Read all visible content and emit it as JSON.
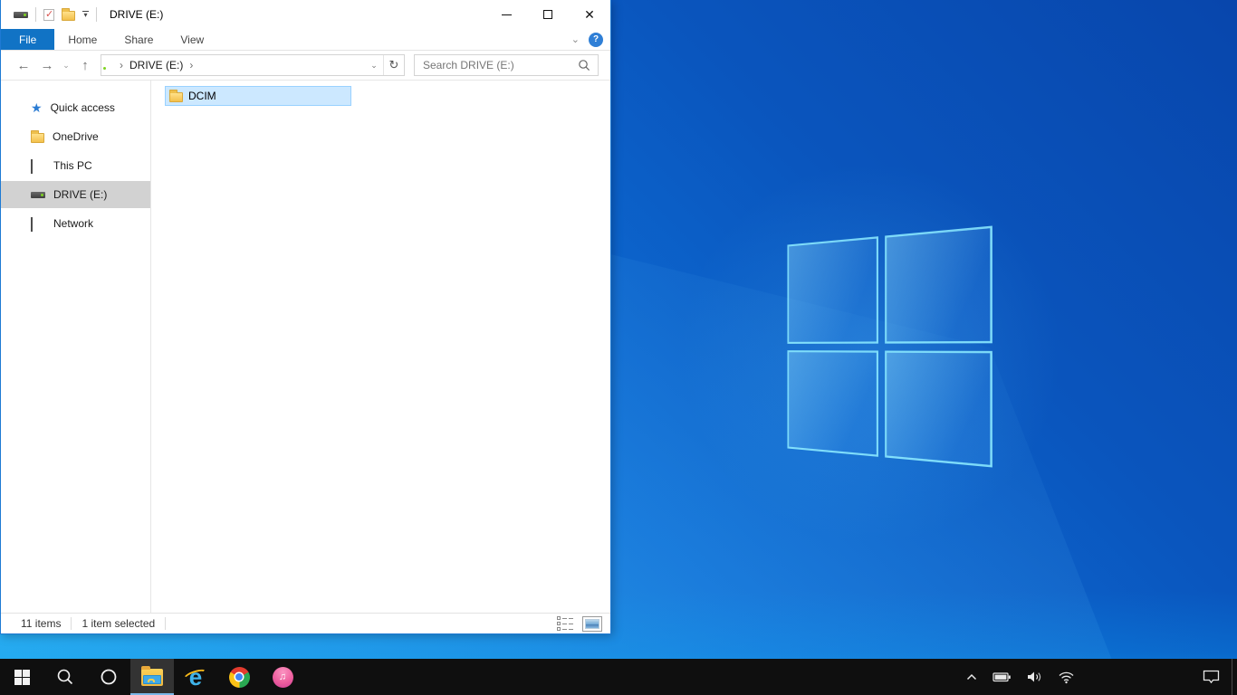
{
  "colors": {
    "accent": "#0078d7",
    "file_tab_bg": "#1173c5",
    "selection_bg": "#cce8ff",
    "selection_border": "#99d1ff",
    "sidebar_selected_bg": "#d2d2d2",
    "taskbar_bg": "#0f0f0f",
    "taskbar_active_underline": "#7ab7e8",
    "wallpaper_dark": "#0846ac",
    "wallpaper_bright": "#14a0ec",
    "logo_pane_border": "#8ceaff",
    "folder_yellow": "#f3c04b"
  },
  "glyphs": {
    "back": "←",
    "forward": "→",
    "up": "↑",
    "chevron_down": "⌄",
    "crumb_sep": "›",
    "refresh": "↻",
    "close": "✕",
    "help": "?",
    "quick_access_star": "★",
    "properties_check": "✓",
    "qat_dropdown": "▾",
    "ie_letter": "e",
    "music_note": "♫"
  },
  "window": {
    "title": "DRIVE (E:)",
    "qat_icons": [
      "drive-icon",
      "properties-icon",
      "new-folder-icon",
      "customize-qat-dropdown"
    ],
    "tabs": [
      {
        "label": "File",
        "active": true
      },
      {
        "label": "Home",
        "active": false
      },
      {
        "label": "Share",
        "active": false
      },
      {
        "label": "View",
        "active": false
      }
    ],
    "nav": {
      "address_crumb": "DRIVE (E:)",
      "search_placeholder": "Search DRIVE (E:)"
    },
    "sidebar": {
      "items": [
        {
          "label": "Quick access",
          "icon": "quick-access-star",
          "selected": false
        },
        {
          "label": "OneDrive",
          "icon": "folder",
          "selected": false
        },
        {
          "label": "This PC",
          "icon": "computer-monitor",
          "selected": false
        },
        {
          "label": "DRIVE (E:)",
          "icon": "hard-drive",
          "selected": true
        },
        {
          "label": "Network",
          "icon": "network-computer",
          "selected": false
        }
      ]
    },
    "files": [
      {
        "name": "DCIM",
        "type": "folder",
        "selected": true
      }
    ],
    "status": {
      "item_count": "11 items",
      "selection": "1 item selected",
      "view_buttons": [
        "details-view",
        "large-thumbnails-view"
      ]
    }
  },
  "taskbar": {
    "buttons": [
      {
        "name": "start"
      },
      {
        "name": "search"
      },
      {
        "name": "cortana"
      },
      {
        "name": "file-explorer",
        "active": true
      },
      {
        "name": "internet-explorer"
      },
      {
        "name": "chrome"
      },
      {
        "name": "itunes"
      }
    ],
    "tray_icons": [
      "show-hidden-icons",
      "battery",
      "volume",
      "wifi"
    ],
    "action_center": "notifications"
  }
}
